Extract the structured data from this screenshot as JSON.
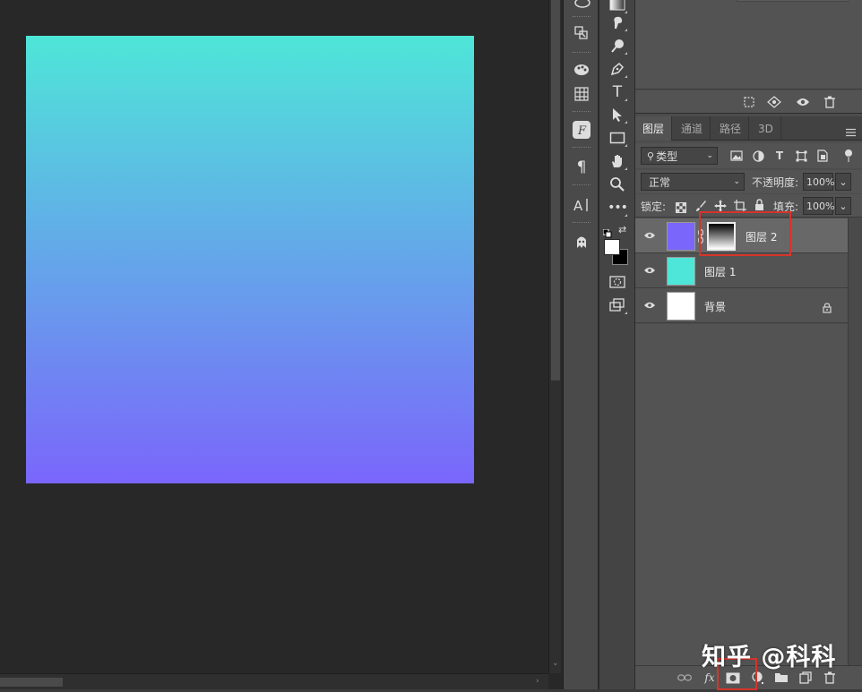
{
  "canvas": {
    "gradient_top": "#4ee6d8",
    "gradient_bottom": "#7a66fb"
  },
  "layers_panel": {
    "tabs": [
      {
        "label": "图层",
        "active": true
      },
      {
        "label": "通道",
        "active": false
      },
      {
        "label": "路径",
        "active": false
      },
      {
        "label": "3D",
        "active": false
      }
    ],
    "filter_kind": "类型",
    "blend_mode": "正常",
    "opacity_label": "不透明度:",
    "opacity_value": "100%",
    "lock_label": "锁定:",
    "fill_label": "填充:",
    "fill_value": "100%",
    "layers": [
      {
        "name": "图层 2",
        "selected": true,
        "thumb_color": "#7a66fb",
        "has_mask": true
      },
      {
        "name": "图层 1",
        "selected": false,
        "thumb_color": "#4ee6d8",
        "has_mask": false
      },
      {
        "name": "背景",
        "selected": false,
        "thumb_color": "#ffffff",
        "locked": true
      }
    ]
  },
  "colors": {
    "foreground": "#ffffff",
    "background": "#000000",
    "highlight_box": "#d6342b"
  },
  "watermark": "知乎 @科科"
}
